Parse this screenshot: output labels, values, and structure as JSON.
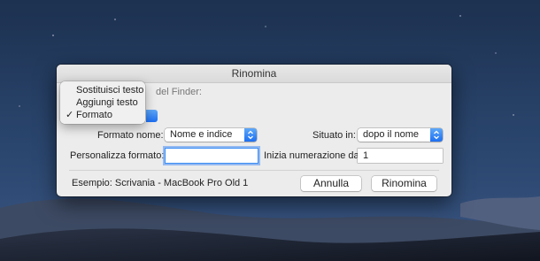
{
  "dialog": {
    "title": "Rinomina",
    "hidden_header_text": "del Finder:"
  },
  "menu": {
    "items": [
      {
        "label": "Sostituisci testo",
        "checked": false
      },
      {
        "label": "Aggiungi testo",
        "checked": false
      },
      {
        "label": "Formato",
        "checked": true
      }
    ],
    "check_glyph": "✓"
  },
  "form": {
    "name_format_label": "Formato nome:",
    "name_format_value": "Nome e indice",
    "where_label": "Situato in:",
    "where_value": "dopo il nome",
    "custom_format_label": "Personalizza formato:",
    "custom_format_value": "",
    "start_number_label": "Inizia numerazione da:",
    "start_number_value": "1"
  },
  "footer": {
    "example_text": "Esempio: Scrivania - MacBook Pro Old 1",
    "cancel_label": "Annulla",
    "rename_label": "Rinomina"
  },
  "colors": {
    "accent": "#1d6ff2",
    "dialog_bg": "#ececec",
    "focus_ring": "#4a90f5"
  },
  "icons": {
    "popup_arrows": "updown-chevron-icon",
    "checkmark": "checkmark-icon"
  }
}
